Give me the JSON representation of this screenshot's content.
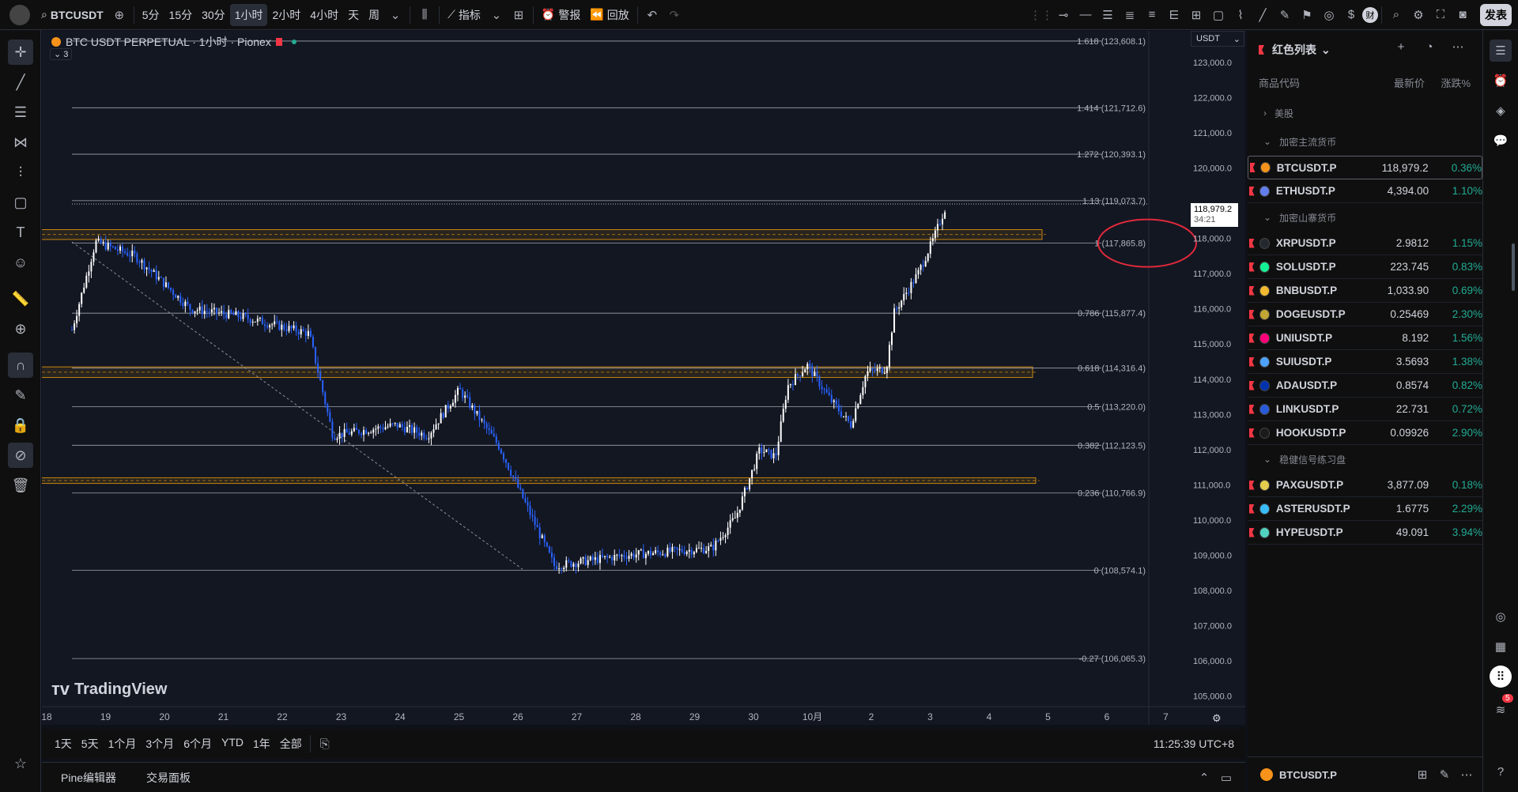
{
  "toolbar": {
    "symbol": "BTCUSDT",
    "intervals": [
      "5分",
      "15分",
      "30分",
      "1小时",
      "2小时",
      "4小时",
      "天",
      "周"
    ],
    "active_interval": "1小时",
    "indicators_label": "指标",
    "alert_label": "警报",
    "replay_label": "回放",
    "publish_label": "发表"
  },
  "legend": {
    "title": "BTC USDT PERPETUAL · 1小时 · Pionex",
    "collapsed_count": "3"
  },
  "price_axis": {
    "currency": "USDT",
    "ticks": [
      "123,000.0",
      "122,000.0",
      "121,000.0",
      "120,000.0",
      "118,000.0",
      "117,000.0",
      "116,000.0",
      "115,000.0",
      "114,000.0",
      "113,000.0",
      "112,000.0",
      "111,000.0",
      "110,000.0",
      "109,000.0",
      "108,000.0",
      "107,000.0",
      "106,000.0",
      "105,000.0"
    ],
    "last_price": "118,979.2",
    "countdown": "34:21"
  },
  "fib_labels": [
    {
      "level": "1.618",
      "text": "1.618 (123,608.1)"
    },
    {
      "level": "1.414",
      "text": "1.414 (121,712.6)"
    },
    {
      "level": "1.272",
      "text": "1.272 (120,393.1)"
    },
    {
      "level": "1.13",
      "text": "1.13 (119,073.7)"
    },
    {
      "level": "1",
      "text": "1 (117,865.8)"
    },
    {
      "level": "0.786",
      "text": "0.786 (115,877.4)"
    },
    {
      "level": "0.618",
      "text": "0.618 (114,316.4)"
    },
    {
      "level": "0.5",
      "text": "0.5 (113,220.0)"
    },
    {
      "level": "0.382",
      "text": "0.382 (112,123.5)"
    },
    {
      "level": "0.236",
      "text": "0.236 (110,766.9)"
    },
    {
      "level": "0",
      "text": "0 (108,574.1)"
    },
    {
      "level": "-0.27",
      "text": "-0.27 (106,065.3)"
    }
  ],
  "time_axis": [
    "18",
    "19",
    "20",
    "21",
    "22",
    "23",
    "24",
    "25",
    "26",
    "27",
    "28",
    "29",
    "30",
    "10月",
    "2",
    "3",
    "4",
    "5",
    "6",
    "7"
  ],
  "watermark": "TradingView",
  "bottom_bar": {
    "ranges": [
      "1天",
      "5天",
      "1个月",
      "3个月",
      "6个月",
      "YTD",
      "1年",
      "全部"
    ],
    "clock": "11:25:39 UTC+8"
  },
  "bottom_panel": {
    "tabs": [
      "Pine编辑器",
      "交易面板"
    ]
  },
  "watchlist": {
    "title": "红色列表",
    "columns": [
      "商品代码",
      "最新价",
      "涨跌%"
    ],
    "groups": [
      {
        "name": "美股",
        "collapsed": true,
        "items": []
      },
      {
        "name": "加密主流货币",
        "collapsed": false,
        "items": [
          {
            "symbol": "BTCUSDT.P",
            "price": "118,979.2",
            "change": "0.36%",
            "coin": "#f7931a"
          },
          {
            "symbol": "ETHUSDT.P",
            "price": "4,394.00",
            "change": "1.10%",
            "coin": "#627eea"
          }
        ]
      },
      {
        "name": "加密山寨货币",
        "collapsed": false,
        "items": [
          {
            "symbol": "XRPUSDT.P",
            "price": "2.9812",
            "change": "1.15%",
            "coin": "#23292f"
          },
          {
            "symbol": "SOLUSDT.P",
            "price": "223.745",
            "change": "0.83%",
            "coin": "#14f195"
          },
          {
            "symbol": "BNBUSDT.P",
            "price": "1,033.90",
            "change": "0.69%",
            "coin": "#f3ba2f"
          },
          {
            "symbol": "DOGEUSDT.P",
            "price": "0.25469",
            "change": "2.30%",
            "coin": "#c2a633"
          },
          {
            "symbol": "UNIUSDT.P",
            "price": "8.192",
            "change": "1.56%",
            "coin": "#ff007a"
          },
          {
            "symbol": "SUIUSDT.P",
            "price": "3.5693",
            "change": "1.38%",
            "coin": "#4da2ff"
          },
          {
            "symbol": "ADAUSDT.P",
            "price": "0.8574",
            "change": "0.82%",
            "coin": "#0033ad"
          },
          {
            "symbol": "LINKUSDT.P",
            "price": "22.731",
            "change": "0.72%",
            "coin": "#2a5ada"
          },
          {
            "symbol": "HOOKUSDT.P",
            "price": "0.09926",
            "change": "2.90%",
            "coin": "#1b1b1b"
          }
        ]
      },
      {
        "name": "稳健信号练习盘",
        "collapsed": false,
        "items": [
          {
            "symbol": "PAXGUSDT.P",
            "price": "3,877.09",
            "change": "0.18%",
            "coin": "#e4ce4d"
          },
          {
            "symbol": "ASTERUSDT.P",
            "price": "1.6775",
            "change": "2.29%",
            "coin": "#38bdf8"
          },
          {
            "symbol": "HYPEUSDT.P",
            "price": "49.091",
            "change": "3.94%",
            "coin": "#50d2c1"
          }
        ]
      }
    ],
    "footer_symbol": "BTCUSDT.P"
  },
  "right_strip": {
    "notification_count": "5"
  },
  "colors": {
    "up": "#ffffff",
    "down": "#2962ff",
    "accent_up": "#22ab94",
    "flag": "#f23645",
    "zone": "#c8860d",
    "circle": "#e0293b"
  }
}
